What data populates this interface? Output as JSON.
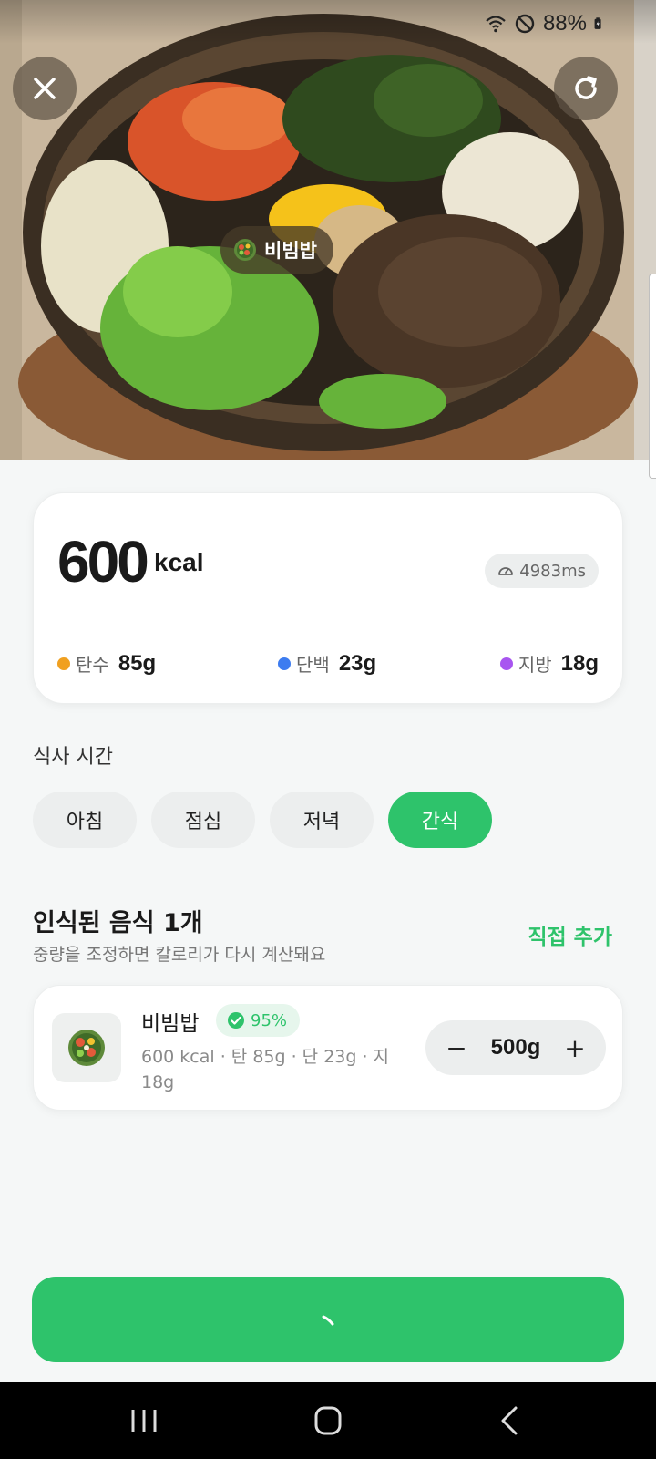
{
  "status": {
    "battery": "88%",
    "icons": [
      "wifi-icon",
      "do-not-disturb-icon",
      "battery-charging-icon"
    ]
  },
  "photo": {
    "food_tag": "비빔밥"
  },
  "summary": {
    "calories": "600",
    "calories_unit": "kcal",
    "analysis_time": "4983ms",
    "macros": [
      {
        "label": "탄수",
        "value": "85g",
        "color": "#f0a020"
      },
      {
        "label": "단백",
        "value": "23g",
        "color": "#3d7cf0"
      },
      {
        "label": "지방",
        "value": "18g",
        "color": "#a855f0"
      }
    ]
  },
  "meal_time": {
    "label": "식사 시간",
    "options": [
      "아침",
      "점심",
      "저녁",
      "간식"
    ],
    "selected": "간식"
  },
  "recognized": {
    "title": "인식된 음식 1개",
    "subtitle": "중량을 조정하면 칼로리가 다시 계산돼요",
    "add_link": "직접 추가",
    "items": [
      {
        "name": "비빔밥",
        "confidence": "95%",
        "detail": "600 kcal · 탄 85g · 단 23g · 지 18g",
        "weight": "500g"
      }
    ]
  },
  "colors": {
    "accent": "#2ec36b",
    "background": "#f5f7f7"
  }
}
